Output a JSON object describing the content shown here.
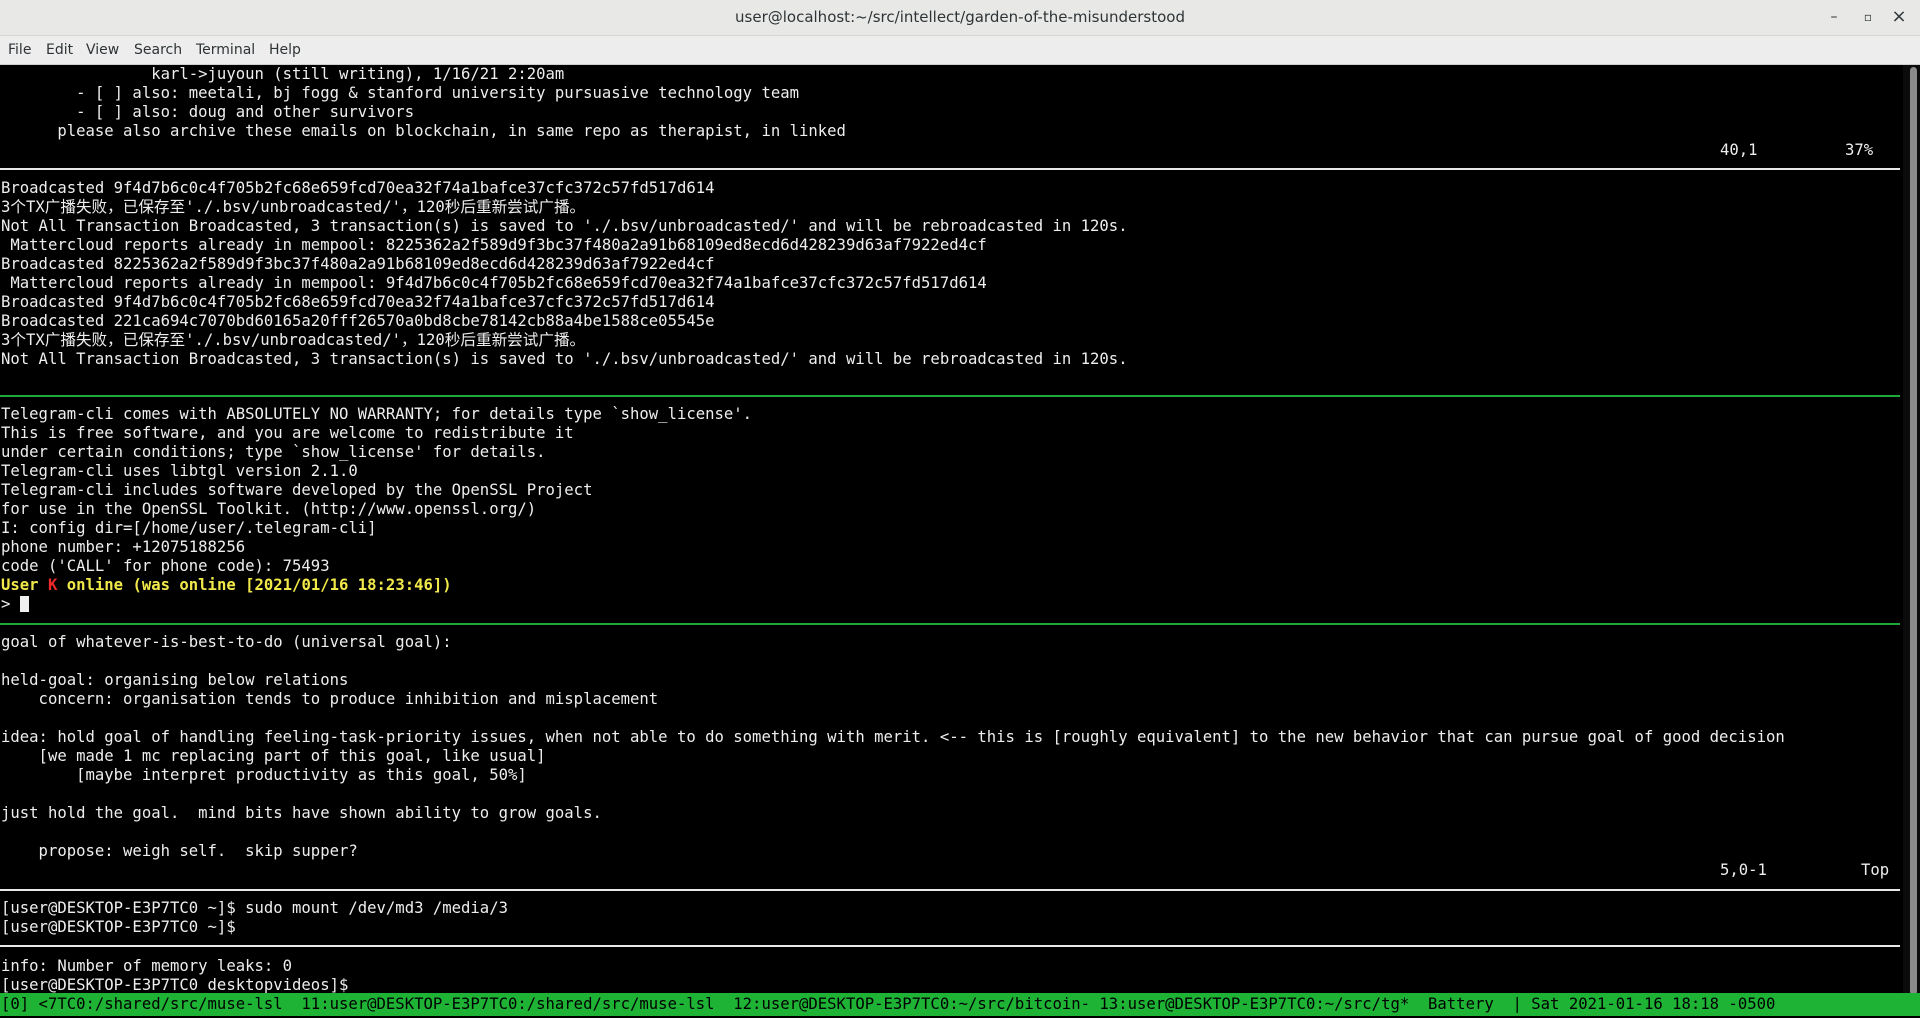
{
  "window": {
    "title": "user@localhost:~/src/intellect/garden-of-the-misunderstood",
    "controls": [
      "–",
      "▫",
      "×"
    ]
  },
  "menu": [
    "File",
    "Edit",
    "View",
    "Search",
    "Terminal",
    "Help"
  ],
  "pane1": {
    "lines": [
      "                karl->juyoun (still writing), 1/16/21 2:20am",
      "        - [ ] also: meetali, bj fogg & stanford university pursuasive technology team",
      "        - [ ] also: doug and other survivors",
      "      please also archive these emails on blockchain, in same repo as therapist, in linked"
    ],
    "ruler_pos": "40,1",
    "ruler_pct": "37%"
  },
  "pane2": {
    "lines": [
      "Broadcasted 9f4d7b6c0c4f705b2fc68e659fcd70ea32f74a1bafce37cfc372c57fd517d614",
      "3个TX广播失败，已保存至'./.bsv/unbroadcasted/'，120秒后重新尝试广播。",
      "Not All Transaction Broadcasted, 3 transaction(s) is saved to './.bsv/unbroadcasted/' and will be rebroadcasted in 120s.",
      " Mattercloud reports already in mempool: 8225362a2f589d9f3bc37f480a2a91b68109ed8ecd6d428239d63af7922ed4cf",
      "Broadcasted 8225362a2f589d9f3bc37f480a2a91b68109ed8ecd6d428239d63af7922ed4cf",
      " Mattercloud reports already in mempool: 9f4d7b6c0c4f705b2fc68e659fcd70ea32f74a1bafce37cfc372c57fd517d614",
      "Broadcasted 9f4d7b6c0c4f705b2fc68e659fcd70ea32f74a1bafce37cfc372c57fd517d614",
      "Broadcasted 221ca694c7070bd60165a20fff26570a0bd8cbe78142cb88a4be1588ce05545e",
      "3个TX广播失败，已保存至'./.bsv/unbroadcasted/'，120秒后重新尝试广播。",
      "Not All Transaction Broadcasted, 3 transaction(s) is saved to './.bsv/unbroadcasted/' and will be rebroadcasted in 120s."
    ]
  },
  "pane3": {
    "lines": [
      "Telegram-cli comes with ABSOLUTELY NO WARRANTY; for details type `show_license'.",
      "This is free software, and you are welcome to redistribute it",
      "under certain conditions; type `show_license' for details.",
      "Telegram-cli uses libtgl version 2.1.0",
      "Telegram-cli includes software developed by the OpenSSL Project",
      "for use in the OpenSSL Toolkit. (http://www.openssl.org/)",
      "I: config dir=[/home/user/.telegram-cli]",
      "phone number: +12075188256",
      "code ('CALL' for phone code): 75493"
    ],
    "online_prefix": "User ",
    "online_user": "K",
    "online_suffix": " online (was online [2021/01/16 18:23:46])",
    "prompt": "> "
  },
  "pane4": {
    "lines": [
      "goal of whatever-is-best-to-do (universal goal):",
      "",
      "held-goal: organising below relations",
      "    concern: organisation tends to produce inhibition and misplacement",
      "",
      "idea: hold goal of handling feeling-task-priority issues, when not able to do something with merit. <-- this is [roughly equivalent] to the new behavior that can pursue goal of good decision",
      "    [we made 1 mc replacing part of this goal, like usual]",
      "        [maybe interpret productivity as this goal, 50%]",
      "",
      "just hold the goal.  mind bits have shown ability to grow goals.",
      "",
      "    propose: weigh self.  skip supper?"
    ],
    "ruler_pos": "5,0-1",
    "ruler_pct": "Top"
  },
  "pane5": {
    "lines": [
      "[user@DESKTOP-E3P7TC0 ~]$ sudo mount /dev/md3 /media/3",
      "[user@DESKTOP-E3P7TC0 ~]$"
    ]
  },
  "pane6": {
    "lines": [
      "info: Number of memory leaks: 0",
      "[user@DESKTOP-E3P7TC0 desktopvideos]$"
    ]
  },
  "tmux_status": "[0] <7TC0:/shared/src/muse-lsl  11:user@DESKTOP-E3P7TC0:/shared/src/muse-lsl  12:user@DESKTOP-E3P7TC0:~/src/bitcoin- 13:user@DESKTOP-E3P7TC0:~/src/tg*  Battery  | Sat 2021-01-16 18:18 -0500",
  "colors": {
    "terminal_bg": "#000000",
    "pane_border_active": "#1fa83a",
    "pane_border": "#e8e8e8",
    "status_bar": "#1fb335",
    "online_highlight": "#f1e84a",
    "user_highlight": "#ef2929"
  }
}
